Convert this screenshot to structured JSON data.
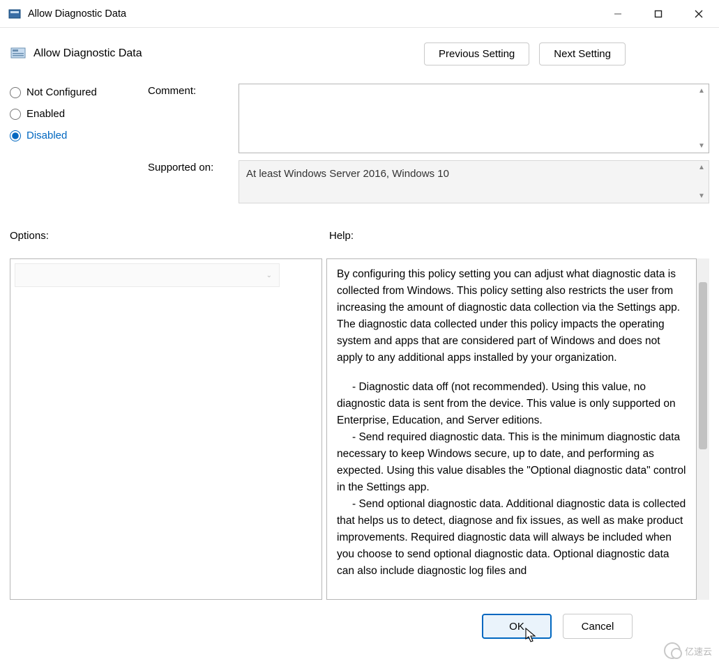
{
  "window": {
    "title": "Allow Diagnostic Data"
  },
  "header": {
    "title": "Allow Diagnostic Data",
    "prev_button": "Previous Setting",
    "next_button": "Next Setting"
  },
  "state": {
    "not_configured": "Not Configured",
    "enabled": "Enabled",
    "disabled": "Disabled",
    "selected": "disabled"
  },
  "fields": {
    "comment_label": "Comment:",
    "comment_value": "",
    "supported_label": "Supported on:",
    "supported_value": "At least Windows Server 2016, Windows 10"
  },
  "sections": {
    "options_label": "Options:",
    "help_label": "Help:"
  },
  "help": {
    "p1": "By configuring this policy setting you can adjust what diagnostic data is collected from Windows. This policy setting also restricts the user from increasing the amount of diagnostic data collection via the Settings app. The diagnostic data collected under this policy impacts the operating system and apps that are considered part of Windows and does not apply to any additional apps installed by your organization.",
    "b1": "- Diagnostic data off (not recommended). Using this value, no diagnostic data is sent from the device. This value is only supported on Enterprise, Education, and Server editions.",
    "b2": "- Send required diagnostic data. This is the minimum diagnostic data necessary to keep Windows secure, up to date, and performing as expected. Using this value disables the \"Optional diagnostic data\" control in the Settings app.",
    "b3": "- Send optional diagnostic data. Additional diagnostic data is collected that helps us to detect, diagnose and fix issues, as well as make product improvements. Required diagnostic data will always be included when you choose to send optional diagnostic data. Optional diagnostic data can also include diagnostic log files and"
  },
  "footer": {
    "ok": "OK",
    "cancel": "Cancel"
  },
  "watermark": "亿速云"
}
